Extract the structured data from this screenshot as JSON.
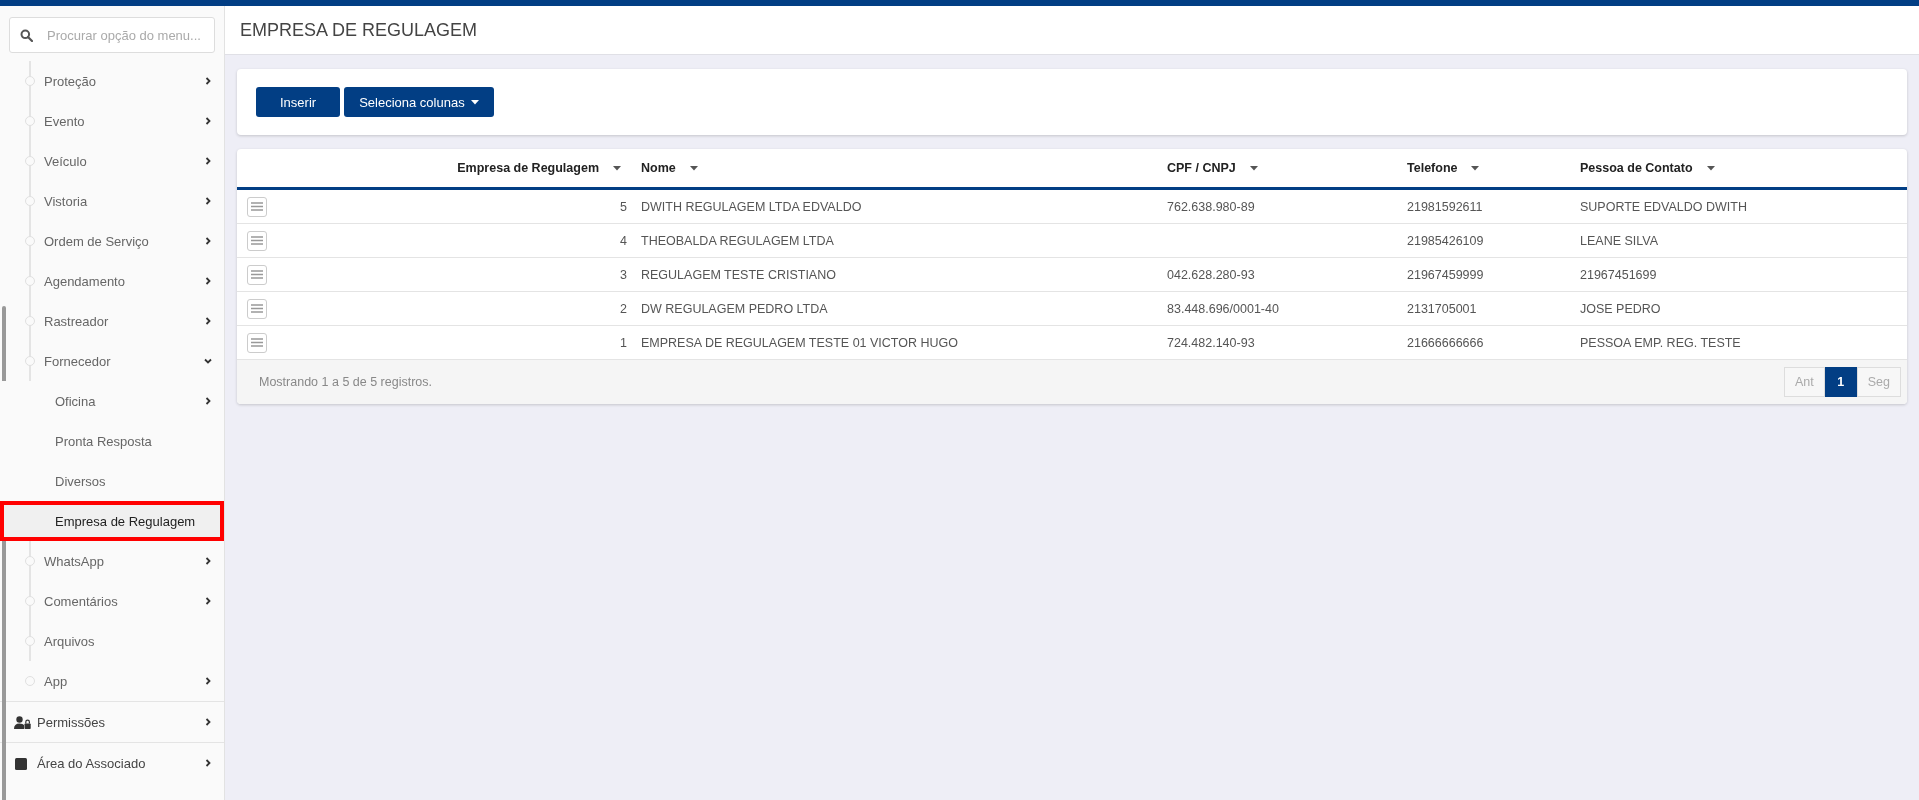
{
  "sidebar": {
    "search": {
      "placeholder": "Procurar opção do menu..."
    },
    "items": [
      {
        "label": "Proteção",
        "kind": "submenu",
        "expanded": false,
        "selected": false
      },
      {
        "label": "Evento",
        "kind": "submenu",
        "expanded": false,
        "selected": false
      },
      {
        "label": "Veículo",
        "kind": "submenu",
        "expanded": false,
        "selected": false
      },
      {
        "label": "Vistoria",
        "kind": "submenu",
        "expanded": false,
        "selected": false
      },
      {
        "label": "Ordem de Serviço",
        "kind": "submenu",
        "expanded": false,
        "selected": false
      },
      {
        "label": "Agendamento",
        "kind": "submenu",
        "expanded": false,
        "selected": false
      },
      {
        "label": "Rastreador",
        "kind": "submenu",
        "expanded": false,
        "selected": false
      },
      {
        "label": "Fornecedor",
        "kind": "submenu",
        "expanded": true,
        "selected": false,
        "children": [
          {
            "label": "Oficina",
            "kind": "submenu",
            "selected": false,
            "highlighted": false
          },
          {
            "label": "Pronta Resposta",
            "kind": "link",
            "selected": false,
            "highlighted": false
          },
          {
            "label": "Diversos",
            "kind": "link",
            "selected": false,
            "highlighted": false
          },
          {
            "label": "Empresa de Regulagem",
            "kind": "link",
            "selected": true,
            "highlighted": true
          }
        ]
      },
      {
        "label": "WhatsApp",
        "kind": "submenu",
        "expanded": false,
        "selected": false
      },
      {
        "label": "Comentários",
        "kind": "submenu",
        "expanded": false,
        "selected": false
      },
      {
        "label": "Arquivos",
        "kind": "link",
        "selected": false
      },
      {
        "label": "App",
        "kind": "submenu",
        "expanded": false,
        "selected": false
      }
    ],
    "sections": [
      {
        "label": "Permissões"
      },
      {
        "label": "Área do Associado"
      }
    ]
  },
  "page": {
    "title": "EMPRESA DE REGULAGEM"
  },
  "toolbar": {
    "buttons": [
      {
        "label": "Inserir",
        "kind": "button"
      },
      {
        "label": "Seleciona colunas",
        "kind": "dropdown"
      }
    ]
  },
  "table": {
    "columns": [
      "Empresa de Regulagem",
      "Nome",
      "CPF / CNPJ",
      "Telefone",
      "Pessoa de Contato"
    ],
    "rows": [
      {
        "id": "5",
        "nome": "DWITH REGULAGEM LTDA EDVALDO",
        "cpf": "762.638.980-89",
        "telefone": "21981592611",
        "contato": "SUPORTE EDVALDO DWITH"
      },
      {
        "id": "4",
        "nome": "THEOBALDA REGULAGEM LTDA",
        "telefone": "21985426109",
        "contato": "LEANE SILVA"
      },
      {
        "id": "3",
        "nome": "REGULAGEM TESTE CRISTIANO",
        "cpf": "042.628.280-93",
        "telefone": "21967459999",
        "contato": "21967451699"
      },
      {
        "id": "2",
        "nome": "DW REGULAGEM PEDRO LTDA",
        "cpf": "83.448.696/0001-40",
        "telefone": "2131705001",
        "contato": "JOSE PEDRO"
      },
      {
        "id": "1",
        "nome": "EMPRESA DE REGULAGEM TESTE 01 VICTOR HUGO",
        "cpf": "724.482.140-93",
        "telefone": "21666666666",
        "contato": "PESSOA EMP. REG. TESTE"
      }
    ],
    "info": "Mostrando 1 a 5 de 5 registros.",
    "pagination": [
      {
        "label": "Ant",
        "selected": false,
        "disabled": true
      },
      {
        "label": "1",
        "selected": true,
        "disabled": false
      },
      {
        "label": "Seg",
        "selected": false,
        "disabled": true
      }
    ]
  }
}
